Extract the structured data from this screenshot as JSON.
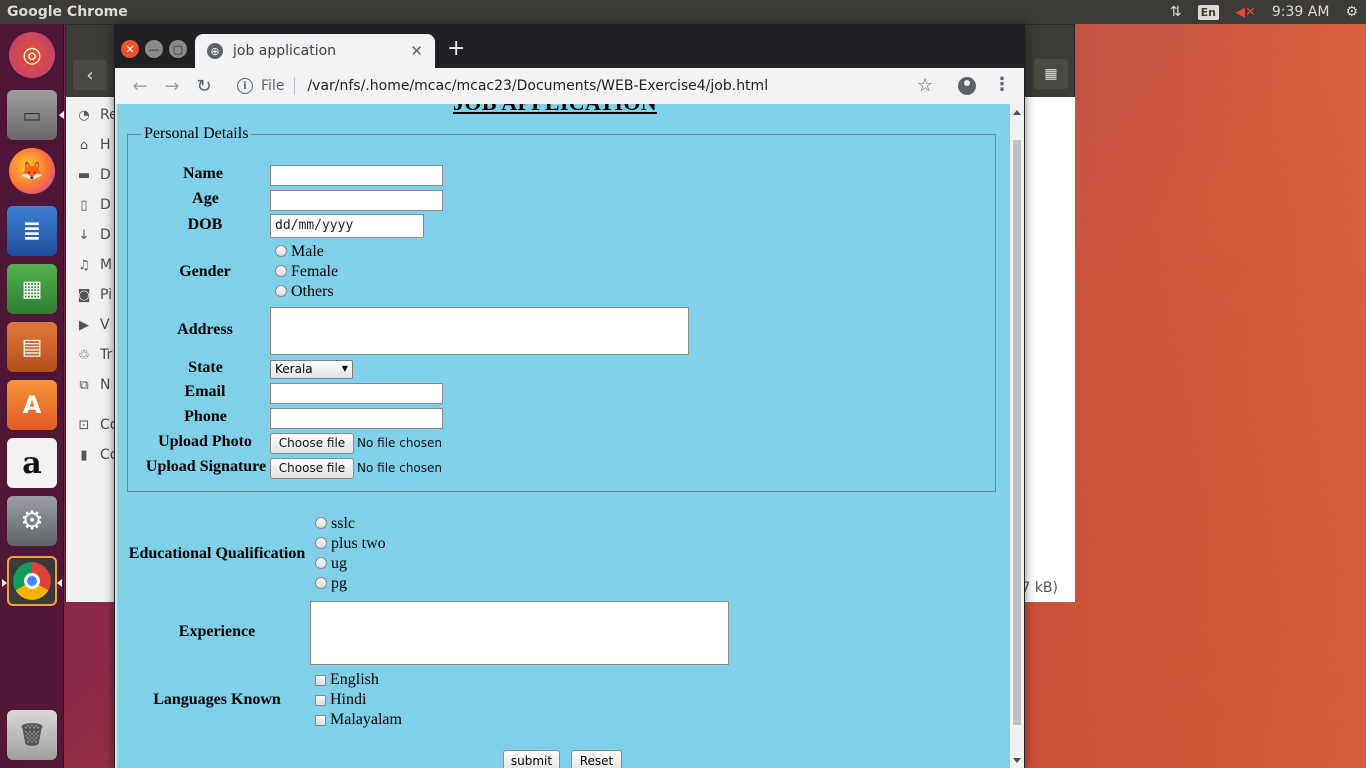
{
  "top_panel": {
    "app_title": "Google Chrome",
    "language": "En",
    "clock": "9:39 AM"
  },
  "launcher": {
    "items": [
      "ubuntu-dash",
      "files",
      "firefox",
      "libreoffice-writer",
      "libreoffice-calc",
      "libreoffice-impress",
      "ubuntu-software",
      "amazon",
      "system-settings",
      "chrome",
      "trash"
    ]
  },
  "files_window": {
    "sidebar_items": [
      "Re",
      "H",
      "D",
      "D",
      "D",
      "M",
      "Pi",
      "V",
      "Tr",
      "N",
      "Co",
      "Co"
    ],
    "size_text": "7 kB)"
  },
  "browser": {
    "tab_title": "job application",
    "scheme": "File",
    "url": "/var/nfs/.home/mcac/mcac23/Documents/WEB-Exercise4/job.html"
  },
  "page": {
    "heading": "JOB APPLICATION",
    "personal_legend": "Personal Details",
    "labels": {
      "name": "Name",
      "age": "Age",
      "dob": "DOB",
      "gender": "Gender",
      "address": "Address",
      "state": "State",
      "email": "Email",
      "phone": "Phone",
      "upload_photo": "Upload Photo",
      "upload_signature": "Upload Signature",
      "education": "Educational Qualification",
      "experience": "Experience",
      "languages": "Languages Known"
    },
    "dob_placeholder": "dd/mm/yyyy",
    "gender_options": [
      "Male",
      "Female",
      "Others"
    ],
    "state_selected": "Kerala",
    "file_button": "Choose file",
    "file_status": "No file chosen",
    "education_options": [
      "sslc",
      "plus two",
      "ug",
      "pg"
    ],
    "language_options": [
      "English",
      "Hindi",
      "Malayalam"
    ],
    "submit_label": "submit",
    "reset_label": "Reset"
  }
}
